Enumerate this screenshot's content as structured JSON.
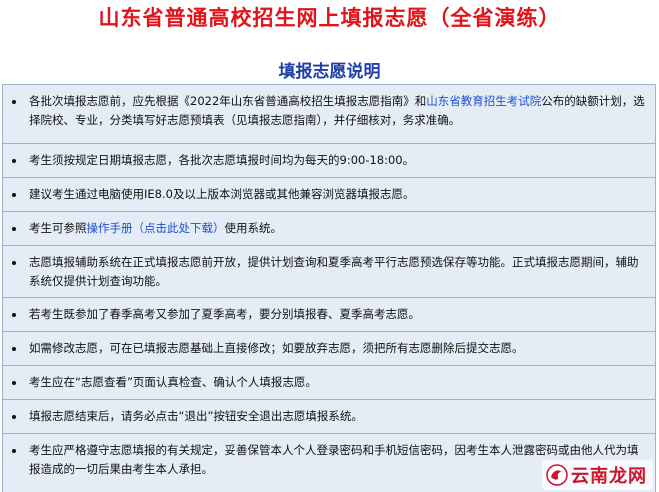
{
  "header": {
    "title": "山东省普通高校招生网上填报志愿（全省演练）",
    "subtitle": "填报志愿说明"
  },
  "notices": [
    {
      "pre": "各批次填报志愿前，应先根据《2022年山东省普通高校招生填报志愿指南》和",
      "link": "山东省教育招生考试院",
      "post": "公布的缺额计划，选择院校、专业，分类填写好志愿预填表（见填报志愿指南），并仔细核对，务求准确。"
    },
    {
      "text": "考生须按规定日期填报志愿，各批次志愿填报时间均为每天的9:00-18:00。"
    },
    {
      "text": "建议考生通过电脑使用IE8.0及以上版本浏览器或其他兼容浏览器填报志愿。"
    },
    {
      "pre": "考生可参照",
      "link": "操作手册（点击此处下载）",
      "post": "使用系统。"
    },
    {
      "text": "志愿填报辅助系统在正式填报志愿前开放，提供计划查询和夏季高考平行志愿预选保存等功能。正式填报志愿期间，辅助系统仅提供计划查询功能。"
    },
    {
      "text": "若考生既参加了春季高考又参加了夏季高考，要分别填报春、夏季高考志愿。"
    },
    {
      "text": "如需修改志愿，可在已填报志愿基础上直接修改；如要放弃志愿，须把所有志愿删除后提交志愿。"
    },
    {
      "text": "考生应在“志愿查看”页面认真检查、确认个人填报志愿。"
    },
    {
      "text": "填报志愿结束后，请务必点击“退出”按钮安全退出志愿填报系统。"
    },
    {
      "text": "考生应严格遵守志愿填报的有关规定，妥善保管本人个人登录密码和手机短信密码，因考生本人泄露密码或由他人代为填报造成的一切后果由考生本人承担。"
    }
  ],
  "watermark": {
    "text": "云南龙网",
    "icon": "dragon-logo-icon"
  },
  "colors": {
    "title": "#e0141a",
    "subtitle": "#1f3fa8",
    "row_bg": "#e4ecf6",
    "link": "#1f4fd1",
    "border": "#9fb4c8"
  }
}
